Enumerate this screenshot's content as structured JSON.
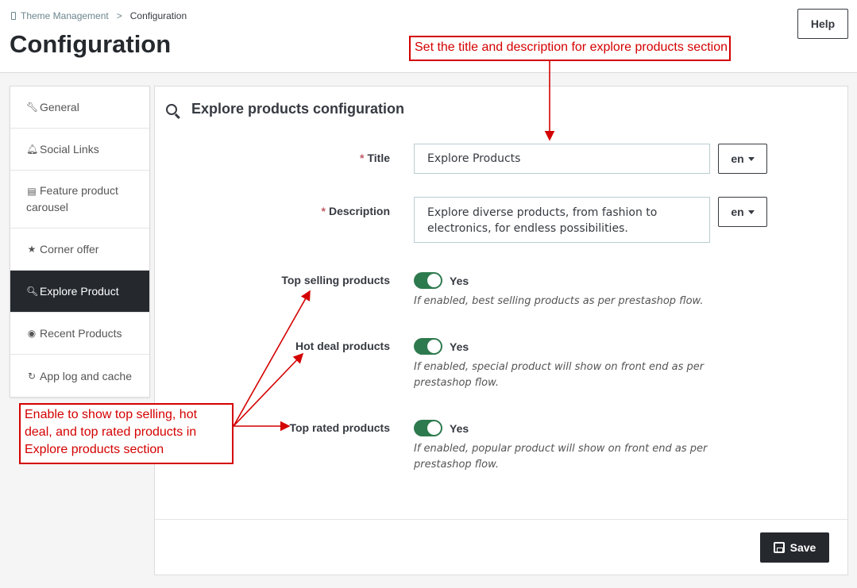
{
  "breadcrumb": {
    "parent": "Theme Management",
    "separator": ">",
    "current": "Configuration"
  },
  "page_title": "Configuration",
  "help_label": "Help",
  "sidebar": {
    "items": [
      {
        "label": "General",
        "icon": "wrench-icon",
        "active": false
      },
      {
        "label": "Social Links",
        "icon": "bell-icon",
        "active": false
      },
      {
        "label": "Feature product carousel",
        "icon": "archive-icon",
        "active": false
      },
      {
        "label": "Corner offer",
        "icon": "star-icon",
        "active": false
      },
      {
        "label": "Explore Product",
        "icon": "search-icon",
        "active": true
      },
      {
        "label": "Recent Products",
        "icon": "eye-icon",
        "active": false
      },
      {
        "label": "App log and cache",
        "icon": "refresh-icon",
        "active": false
      }
    ]
  },
  "panel": {
    "heading": "Explore products configuration",
    "title_field": {
      "label": "Title",
      "required_mark": "*",
      "value": "Explore Products",
      "lang": "en"
    },
    "description_field": {
      "label": "Description",
      "required_mark": "*",
      "value": "Explore diverse products, from fashion to electronics, for endless possibilities.",
      "lang": "en"
    },
    "toggles": [
      {
        "label": "Top selling products",
        "state": "Yes",
        "help": "If enabled, best selling products as per prestashop flow."
      },
      {
        "label": "Hot deal products",
        "state": "Yes",
        "help": "If enabled, special product will show on front end as per prestashop flow."
      },
      {
        "label": "Top rated products",
        "state": "Yes",
        "help": "If enabled, popular product will show on front end as per prestashop flow."
      }
    ],
    "save_label": "Save"
  },
  "annotations": {
    "top": "Set the title and description for explore products section",
    "left": "Enable to show top selling, hot deal, and top rated products in Explore products section"
  },
  "colors": {
    "accent_dark": "#25292e",
    "toggle_on": "#2e7a4f",
    "annotation": "#d40000",
    "required": "#c05c67"
  }
}
